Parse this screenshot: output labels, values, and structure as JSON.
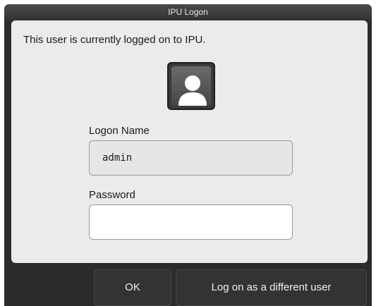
{
  "window": {
    "title": "IPU Logon"
  },
  "message": "This user is currently logged on to IPU.",
  "avatar": {
    "icon": "user-silhouette-icon"
  },
  "logon_name": {
    "label": "Logon Name",
    "value": "admin"
  },
  "password": {
    "label": "Password",
    "value": ""
  },
  "buttons": {
    "ok": "OK",
    "different_user": "Log on as a different user"
  },
  "colors": {
    "window_bg": "#2b2b2b",
    "content_bg": "#ebebeb",
    "button_bg": "#333333"
  }
}
